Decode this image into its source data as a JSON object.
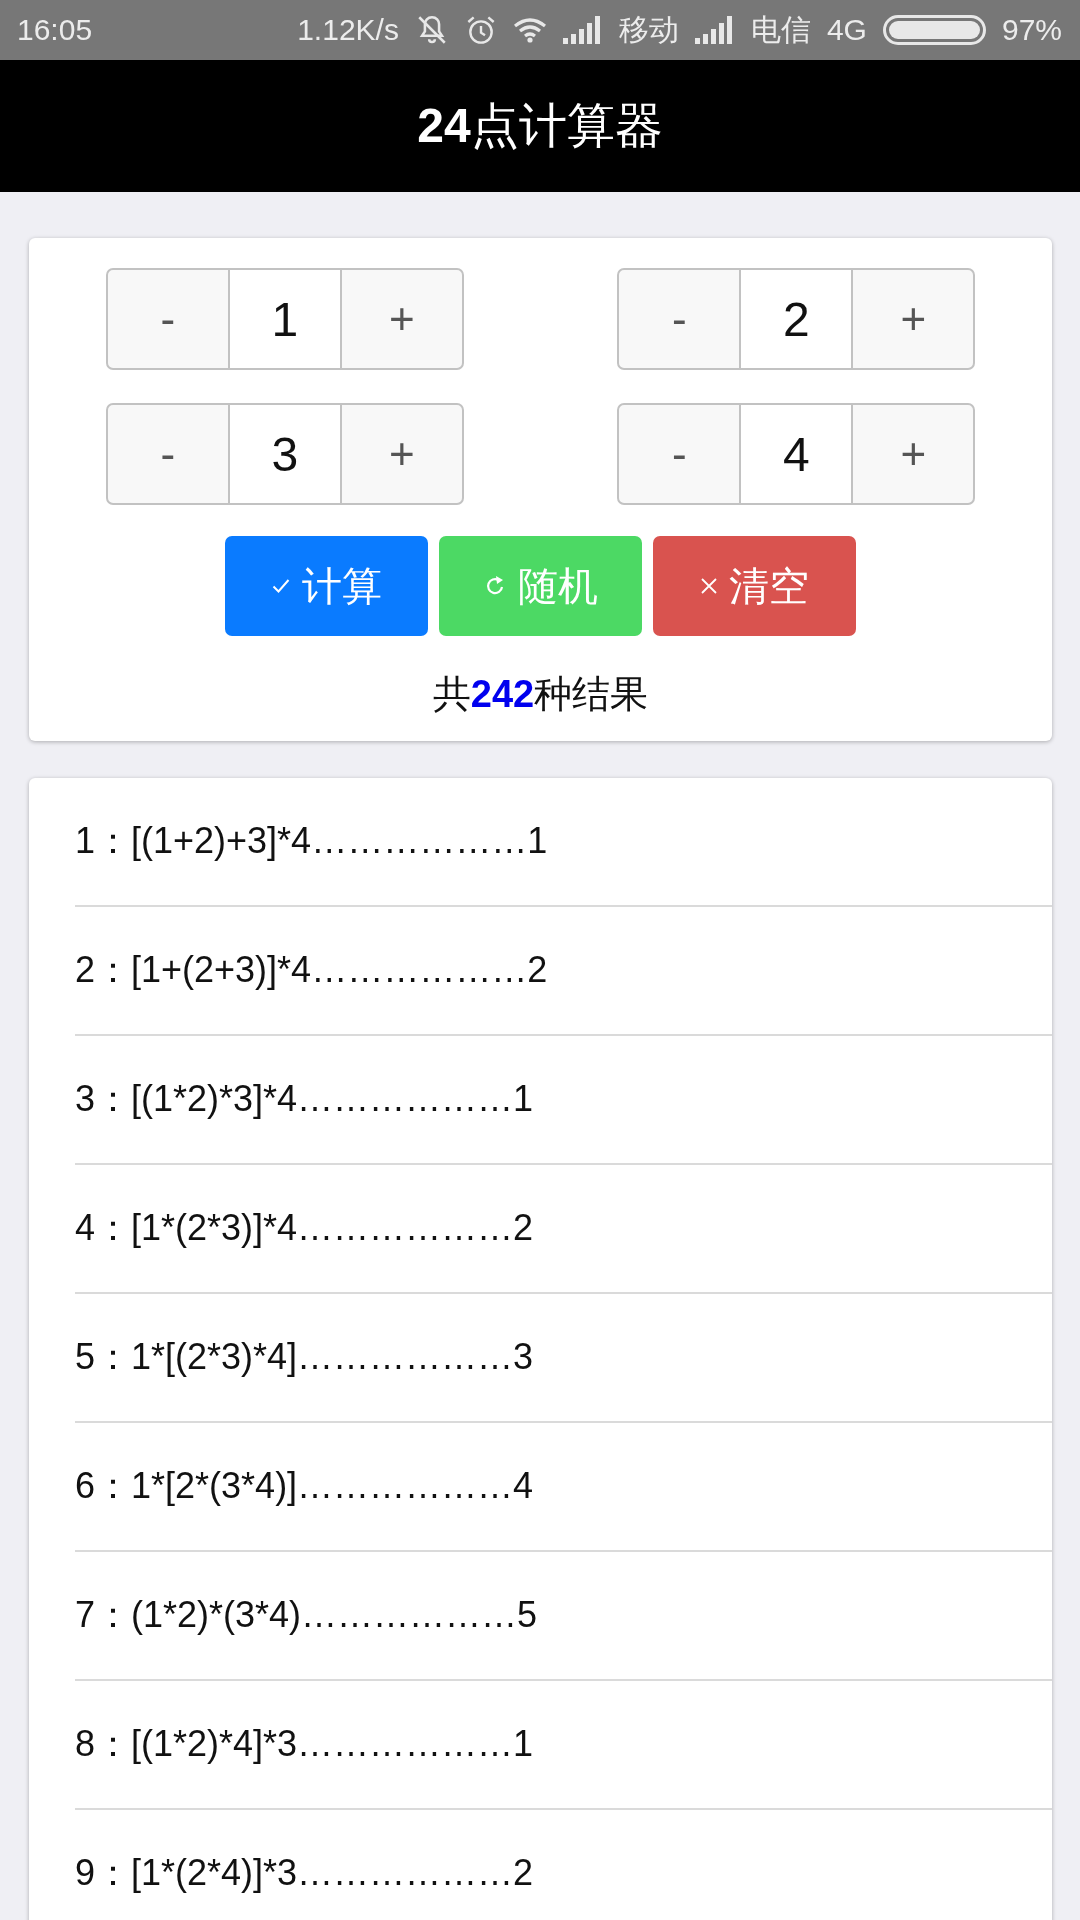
{
  "status_bar": {
    "time": "16:05",
    "speed": "1.12K/s",
    "carrier_1": "移动",
    "carrier_2": "电信",
    "network": "4G",
    "battery": "97%"
  },
  "header": {
    "title": "**24**点计算器"
  },
  "steppers": [
    {
      "decrement": "-",
      "value": "1",
      "increment": "+"
    },
    {
      "decrement": "-",
      "value": "2",
      "increment": "+"
    },
    {
      "decrement": "-",
      "value": "3",
      "increment": "+"
    },
    {
      "decrement": "-",
      "value": "4",
      "increment": "+"
    }
  ],
  "actions": [
    {
      "kind": "calculate",
      "label": "计算"
    },
    {
      "kind": "random",
      "label": "随机"
    },
    {
      "kind": "clear",
      "label": "清空"
    }
  ],
  "result_count": "共**242**种结果",
  "results": [
    "1：[(1+2)+3]*4………………1",
    "2：[1+(2+3)]*4………………2",
    "3：[(1*2)*3]*4………………1",
    "4：[1*(2*3)]*4………………2",
    "5：1*[(2*3)*4]………………3",
    "6：1*[2*(3*4)]………………4",
    "7：(1*2)*(3*4)………………5",
    "8：[(1*2)*4]*3………………1",
    "9：[1*(2*4)]*3………………2"
  ]
}
